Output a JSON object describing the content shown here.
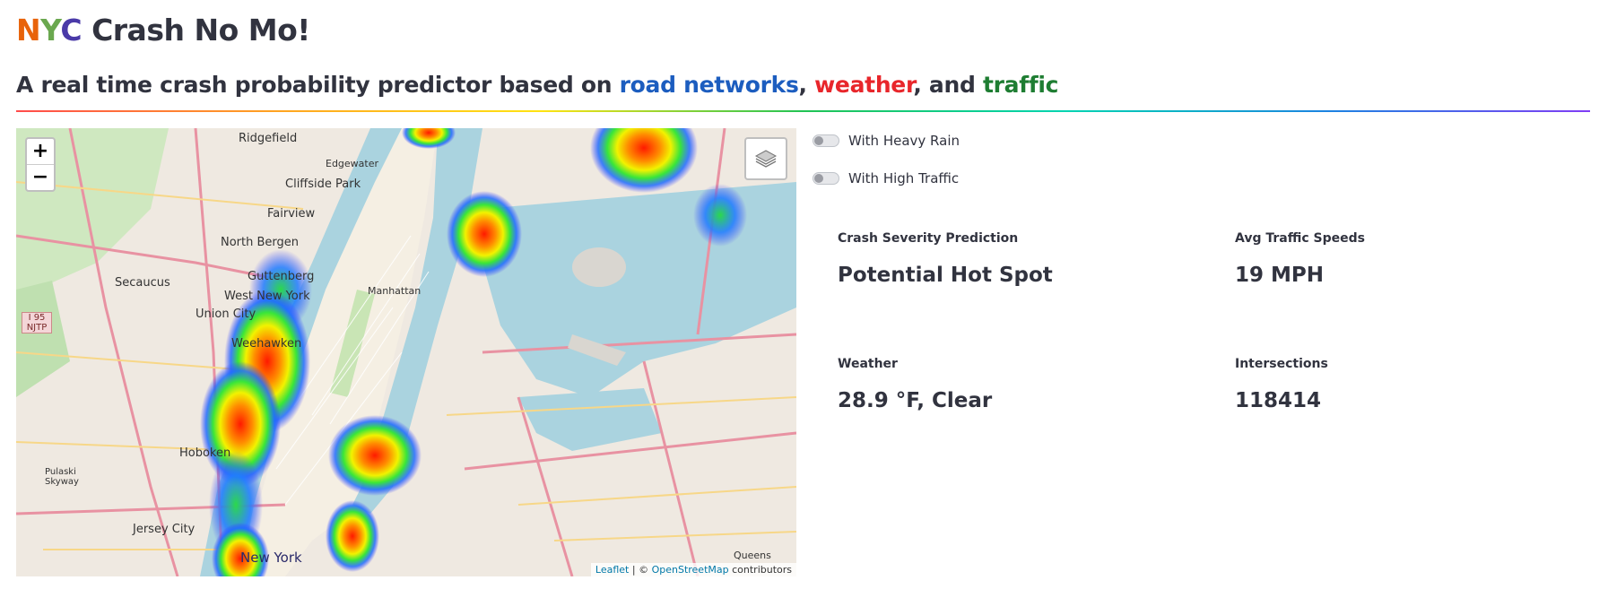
{
  "header": {
    "title_letters": [
      {
        "char": "N",
        "color": "#e8630a"
      },
      {
        "char": "Y",
        "color": "#6aa84f"
      },
      {
        "char": "C",
        "color": "#4a3aa8"
      }
    ],
    "title_rest": " Crash No Mo!",
    "subtitle_pre": "A real time crash probability predictor based on ",
    "subtitle_road": "road networks",
    "subtitle_comma1": ", ",
    "subtitle_weather": "weather",
    "subtitle_and": ", and ",
    "subtitle_traffic": "traffic",
    "colors": {
      "road": "#1c5dbf",
      "weather": "#e8262b",
      "traffic": "#1e7d32"
    }
  },
  "map": {
    "zoom_in": "+",
    "zoom_out": "−",
    "labels": {
      "ridgefield": "Ridgefield",
      "edgewater": "Edgewater",
      "cliffside": "Cliffside Park",
      "fairview": "Fairview",
      "north_bergen": "North Bergen",
      "guttenberg": "Guttenberg",
      "secaucus": "Secaucus",
      "west_new_york": "West New York",
      "union_city": "Union City",
      "weehawken": "Weehawken",
      "hoboken": "Hoboken",
      "jersey_city": "Jersey City",
      "new_york": "New York",
      "manhattan": "Manhattan",
      "queens": "Queens",
      "pulaski": "Pulaski Skyway",
      "njtp": "I 95 NJTP"
    },
    "attribution_leaflet": "Leaflet",
    "attribution_sep": " | © ",
    "attribution_osm": "OpenStreetMap",
    "attribution_rest": " contributors"
  },
  "controls": {
    "heavy_rain": "With Heavy Rain",
    "high_traffic": "With High Traffic"
  },
  "metrics": {
    "severity": {
      "label": "Crash Severity Prediction",
      "value": "Potential Hot Spot"
    },
    "traffic": {
      "label": "Avg Traffic Speeds",
      "value": "19 MPH"
    },
    "weather": {
      "label": "Weather",
      "value": "28.9 °F, Clear"
    },
    "intersections": {
      "label": "Intersections",
      "value": "118414"
    }
  }
}
